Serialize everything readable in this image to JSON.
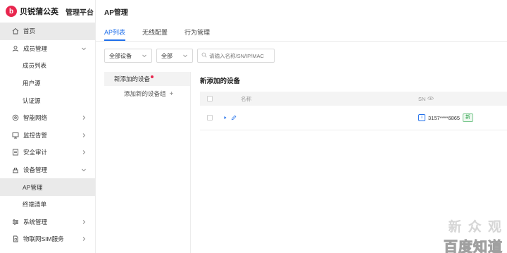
{
  "brand": {
    "logo_glyph": "b",
    "name": "贝锐蒲公英",
    "subtitle": "管理平台",
    "logo_color": "#e8264e"
  },
  "sidebar": {
    "items": [
      {
        "label": "首页",
        "icon": "home-icon",
        "active": true,
        "sub": false
      },
      {
        "label": "成员管理",
        "icon": "user-icon",
        "chevron": "down",
        "sub": false
      },
      {
        "label": "成员列表",
        "sub": true
      },
      {
        "label": "用户源",
        "sub": true
      },
      {
        "label": "认证源",
        "sub": true
      },
      {
        "label": "智能网络",
        "icon": "network-icon",
        "chevron": "right",
        "sub": false
      },
      {
        "label": "监控告警",
        "icon": "monitor-icon",
        "chevron": "right",
        "sub": false
      },
      {
        "label": "安全审计",
        "icon": "audit-icon",
        "chevron": "right",
        "sub": false
      },
      {
        "label": "设备管理",
        "icon": "device-icon",
        "chevron": "down",
        "sub": false
      },
      {
        "label": "AP管理",
        "sub": true,
        "active": true
      },
      {
        "label": "终端清单",
        "sub": true
      },
      {
        "label": "系统管理",
        "icon": "settings-icon",
        "chevron": "right",
        "sub": false
      },
      {
        "label": "物联网SIM服务",
        "icon": "sim-icon",
        "chevron": "right",
        "sub": false
      }
    ]
  },
  "main": {
    "title": "AP管理",
    "tabs": [
      {
        "label": "AP列表",
        "active": true
      },
      {
        "label": "无线配置"
      },
      {
        "label": "行为管理"
      }
    ],
    "filters": {
      "device_select": "全部设备",
      "status_select": "全部",
      "search_placeholder": "请输入名称/SN/IP/MAC"
    },
    "groups": {
      "current": "新添加的设备",
      "add_label": "添加新的设备组"
    },
    "device_panel": {
      "title": "新添加的设备",
      "columns": {
        "name": "名称",
        "sn": "SN"
      },
      "rows": [
        {
          "name": "",
          "sn": "3157****6865",
          "badge": "新"
        }
      ]
    }
  },
  "watermark": {
    "top": "新 众 观",
    "bottom": "百度知道"
  },
  "colors": {
    "accent": "#1f6feb",
    "active_bg": "#eaeaea",
    "new_badge": "#27a046"
  }
}
